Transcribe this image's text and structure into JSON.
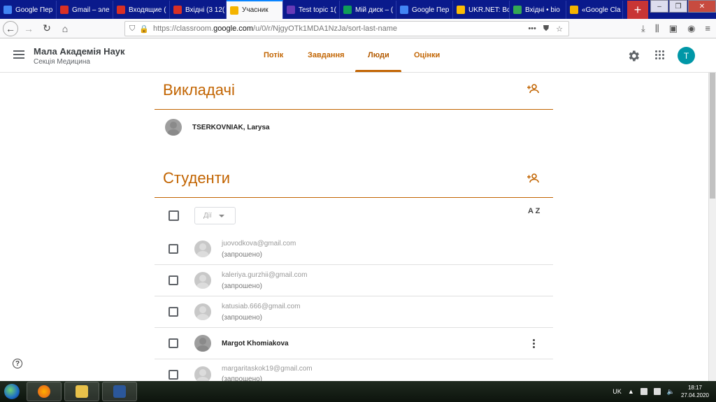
{
  "browser": {
    "tabs": [
      {
        "label": "Google Пер",
        "color": "#4285f4"
      },
      {
        "label": "Gmail – эле",
        "color": "#d93025"
      },
      {
        "label": "Входящие (",
        "color": "#d93025"
      },
      {
        "label": "Вхідні (3 12(",
        "color": "#d93025"
      },
      {
        "label": "Учасник",
        "color": "#f4b400",
        "active": true
      },
      {
        "label": "Test topic 1(",
        "color": "#673ab7"
      },
      {
        "label": "Мій диск – (",
        "color": "#0f9d58"
      },
      {
        "label": "Google Пер",
        "color": "#4285f4"
      },
      {
        "label": "UKR.NET: Вс",
        "color": "#fbbc05"
      },
      {
        "label": "Вхідні • bio",
        "color": "#34a853"
      },
      {
        "label": "«Google Cla",
        "color": "#f4b400"
      }
    ],
    "new_tab_glyph": "+",
    "url": {
      "prefix": "https://classroom.",
      "domain": "google.com",
      "path": "/u/0/r/NjgyOTk1MDA1NzJa/sort-last-name"
    }
  },
  "app": {
    "class_name": "Мала Академія Наук",
    "section": "Секція Медицина",
    "tabs": [
      "Потік",
      "Завдання",
      "Люди",
      "Оцінки"
    ],
    "active_tab": "Люди",
    "avatar_letter": "T"
  },
  "teachers": {
    "heading": "Викладачі",
    "list": [
      {
        "name": "TSERKOVNIAK, Larysa"
      }
    ]
  },
  "students": {
    "heading": "Студенти",
    "actions_label": "Дії",
    "sort_label": "A Z",
    "list": [
      {
        "email": "juovodkova@gmail.com",
        "status": "(запрошено)"
      },
      {
        "email": "kaleriya.gurzhii@gmail.com",
        "status": "(запрошено)"
      },
      {
        "email": "katusiab.666@gmail.com",
        "status": "(запрошено)"
      },
      {
        "name": "Margot Khomiakova"
      },
      {
        "email": "margaritaskok19@gmail.com",
        "status": "(запрошено)"
      }
    ]
  },
  "help_glyph": "?",
  "taskbar": {
    "language": "UK",
    "time": "18:17",
    "date": "27.04.2020"
  },
  "colors": {
    "accent": "#c26401",
    "taskbar": "#1f2a1f"
  }
}
